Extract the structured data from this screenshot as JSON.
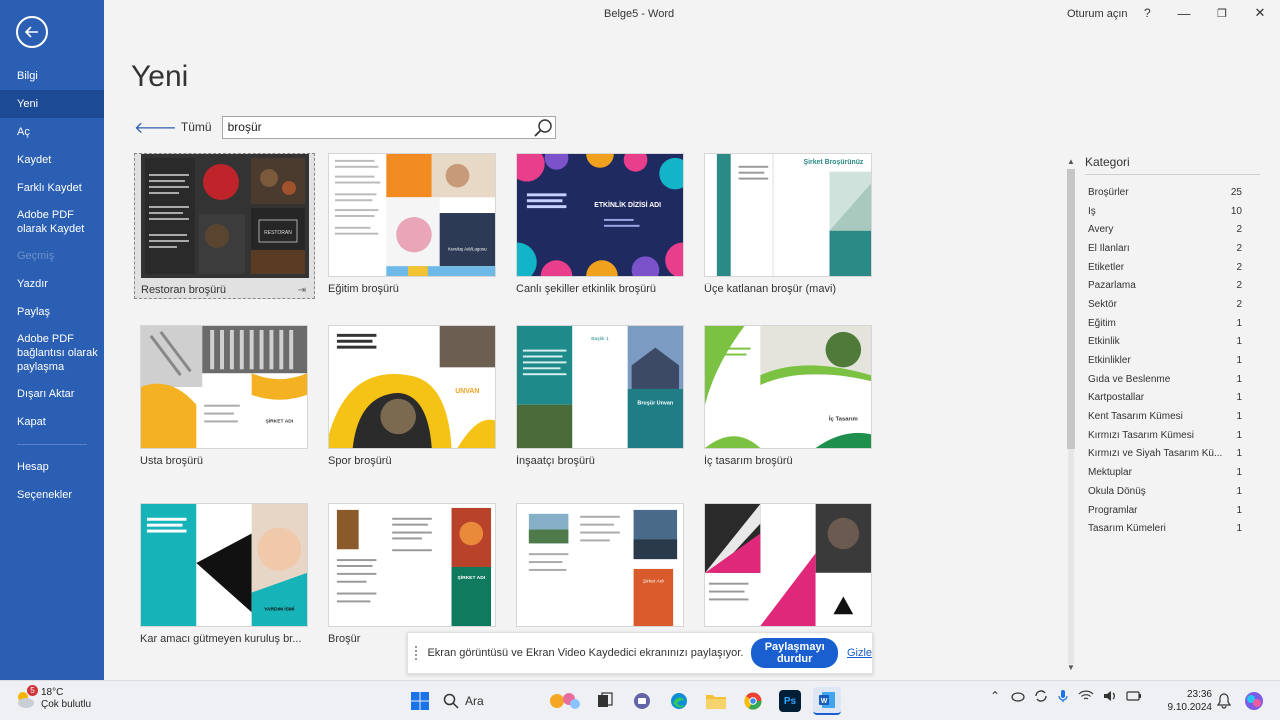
{
  "window": {
    "doc_title": "Belge5  -  Word",
    "signin": "Oturum açın",
    "help": "?",
    "min": "—",
    "restore": "❐",
    "close": "✕"
  },
  "nav": {
    "items": [
      {
        "label": "Bilgi",
        "state": "normal"
      },
      {
        "label": "Yeni",
        "state": "active"
      },
      {
        "label": "Aç",
        "state": "normal"
      },
      {
        "label": "Kaydet",
        "state": "normal"
      },
      {
        "label": "Farklı Kaydet",
        "state": "normal"
      },
      {
        "label": "Adobe PDF olarak Kaydet",
        "state": "normal"
      },
      {
        "label": "Geçmiş",
        "state": "disabled"
      },
      {
        "label": "Yazdır",
        "state": "normal"
      },
      {
        "label": "Paylaş",
        "state": "normal"
      },
      {
        "label": "Adobe PDF bağlantısı olarak paylaşma",
        "state": "normal"
      },
      {
        "label": "Dışarı Aktar",
        "state": "normal"
      },
      {
        "label": "Kapat",
        "state": "normal"
      },
      {
        "label": "Hesap",
        "state": "normal"
      },
      {
        "label": "Seçenekler",
        "state": "normal"
      }
    ]
  },
  "page": {
    "title": "Yeni",
    "back_label": "Tümü",
    "search_value": "broşür"
  },
  "templates": [
    {
      "label": "Restoran broşürü",
      "selected": true,
      "pin": "⇥"
    },
    {
      "label": "Eğitim broşürü"
    },
    {
      "label": "Canlı şekiller etkinlik broşürü"
    },
    {
      "label": "Üçe katlanan broşür (mavi)"
    },
    {
      "label": "Usta broşürü"
    },
    {
      "label": "Spor broşürü"
    },
    {
      "label": "İnşaatçı broşürü"
    },
    {
      "label": "İç tasarım broşürü"
    },
    {
      "label": "Kar amacı gütmeyen kuruluş br..."
    },
    {
      "label": "Broşür"
    },
    {
      "label": ""
    },
    {
      "label": ""
    }
  ],
  "thumb_text": {
    "restoran": "RESTORAN",
    "etkinlik": "ETKİNLİK DİZİSİ ADI",
    "sirket": "Şirket Broşürünüz",
    "sirket_adi": "ŞİRKET ADI",
    "unvan": "UNVAN",
    "baslik": "Başlık 1",
    "brosur_unvan": "Broşür Unvan",
    "ic_tasarim": "İç Tasarım",
    "yardim": "YARDIM İSMİ",
    "sirket_adi2": "Şirket Adı",
    "kurulus": "Kuruluş Adı/Logosu"
  },
  "categories": {
    "heading": "Kategori",
    "items": [
      {
        "name": "Broşürler",
        "count": "25"
      },
      {
        "name": "İş",
        "count": "10"
      },
      {
        "name": "Avery",
        "count": "2"
      },
      {
        "name": "El İlanları",
        "count": "2"
      },
      {
        "name": "Etiketler",
        "count": "2"
      },
      {
        "name": "Pazarlama",
        "count": "2"
      },
      {
        "name": "Sektör",
        "count": "2"
      },
      {
        "name": "Eğitim",
        "count": "1"
      },
      {
        "name": "Etkinlik",
        "count": "1"
      },
      {
        "name": "Etkinlikler",
        "count": "1"
      },
      {
        "name": "Gıda ve Beslenme",
        "count": "1"
      },
      {
        "name": "Kartpostallar",
        "count": "1"
      },
      {
        "name": "Kent Tasarım Kümesi",
        "count": "1"
      },
      {
        "name": "Kırmızı Tasarım Kümesi",
        "count": "1"
      },
      {
        "name": "Kırmızı ve Siyah Tasarım Kü...",
        "count": "1"
      },
      {
        "name": "Mektuplar",
        "count": "1"
      },
      {
        "name": "Okula Dönüş",
        "count": "1"
      },
      {
        "name": "Programlar",
        "count": "1"
      },
      {
        "name": "Tasarım Kümeleri",
        "count": "1"
      }
    ]
  },
  "sharebar": {
    "message": "Ekran görüntüsü ve Ekran Video Kaydedici ekranınızı paylaşıyor.",
    "stop_label": "Paylaşmayı durdur",
    "hide_label": "Gizle"
  },
  "taskbar": {
    "temp": "18°C",
    "weather": "Çok bulutlu",
    "badge": "5",
    "search_label": "Ara",
    "time": "23:36",
    "date": "9.10.2024"
  },
  "colors": {
    "nav_bg": "#2b5fb3",
    "nav_active": "#1d4a94",
    "accent": "#1a5fd0"
  }
}
